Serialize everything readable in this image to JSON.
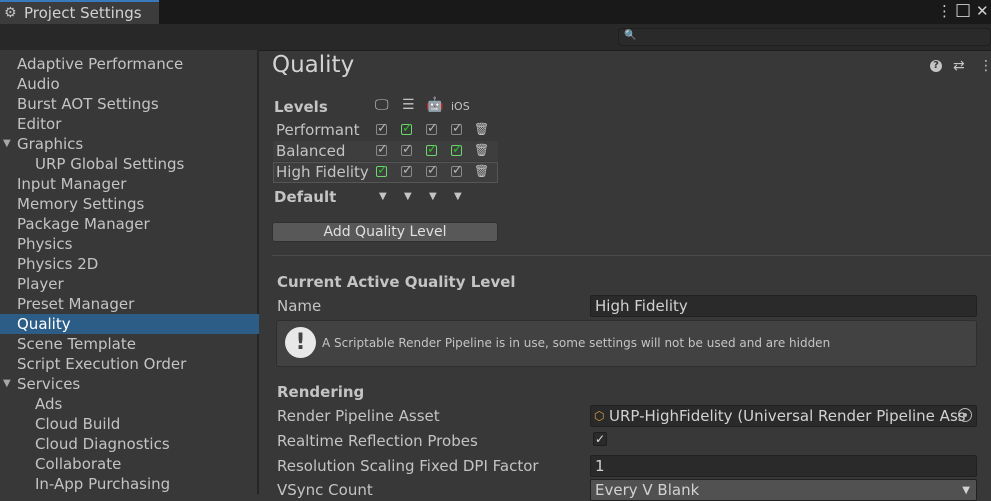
{
  "window": {
    "title": "Project Settings",
    "menu_glyph": "⋮",
    "maximize_glyph": "□",
    "close_glyph": "✕"
  },
  "search": {
    "placeholder": ""
  },
  "sidebar": {
    "items": [
      {
        "label": "Adaptive Performance",
        "indent": 0
      },
      {
        "label": "Audio",
        "indent": 0
      },
      {
        "label": "Burst AOT Settings",
        "indent": 0
      },
      {
        "label": "Editor",
        "indent": 0
      },
      {
        "label": "Graphics",
        "indent": 0,
        "expanded": true
      },
      {
        "label": "URP Global Settings",
        "indent": 1
      },
      {
        "label": "Input Manager",
        "indent": 0
      },
      {
        "label": "Memory Settings",
        "indent": 0
      },
      {
        "label": "Package Manager",
        "indent": 0
      },
      {
        "label": "Physics",
        "indent": 0
      },
      {
        "label": "Physics 2D",
        "indent": 0
      },
      {
        "label": "Player",
        "indent": 0
      },
      {
        "label": "Preset Manager",
        "indent": 0
      },
      {
        "label": "Quality",
        "indent": 0,
        "selected": true
      },
      {
        "label": "Scene Template",
        "indent": 0
      },
      {
        "label": "Script Execution Order",
        "indent": 0
      },
      {
        "label": "Services",
        "indent": 0,
        "expanded": true
      },
      {
        "label": "Ads",
        "indent": 1
      },
      {
        "label": "Cloud Build",
        "indent": 1
      },
      {
        "label": "Cloud Diagnostics",
        "indent": 1
      },
      {
        "label": "Collaborate",
        "indent": 1
      },
      {
        "label": "In-App Purchasing",
        "indent": 1
      }
    ]
  },
  "main": {
    "heading": "Quality",
    "levels_label": "Levels",
    "ios_label": "iOS",
    "platforms": [
      "standalone",
      "server",
      "android",
      "ios"
    ],
    "levels": [
      {
        "name": "Performant",
        "enabled": [
          false,
          true,
          false,
          false
        ]
      },
      {
        "name": "Balanced",
        "enabled": [
          false,
          false,
          true,
          true
        ]
      },
      {
        "name": "High Fidelity",
        "enabled": [
          true,
          false,
          false,
          false
        ]
      }
    ],
    "default_label": "Default",
    "add_button": "Add Quality Level",
    "current_section": "Current Active Quality Level",
    "name_label": "Name",
    "name_value": "High Fidelity",
    "info_icon": "!",
    "info_text": "A Scriptable Render Pipeline is in use, some settings will not be used and are hidden",
    "rendering_section": "Rendering",
    "rpa_label": "Render Pipeline Asset",
    "rpa_value": "URP-HighFidelity (Universal Render Pipeline Ass",
    "reflection_label": "Realtime Reflection Probes",
    "reflection_checked": true,
    "resolution_label": "Resolution Scaling Fixed DPI Factor",
    "resolution_value": "1",
    "vsync_label": "VSync Count",
    "vsync_value": "Every V Blank"
  },
  "colors": {
    "selection": "#2c5d87",
    "check_green": "#2fbd2f",
    "tab_accent": "#3a79bb"
  }
}
